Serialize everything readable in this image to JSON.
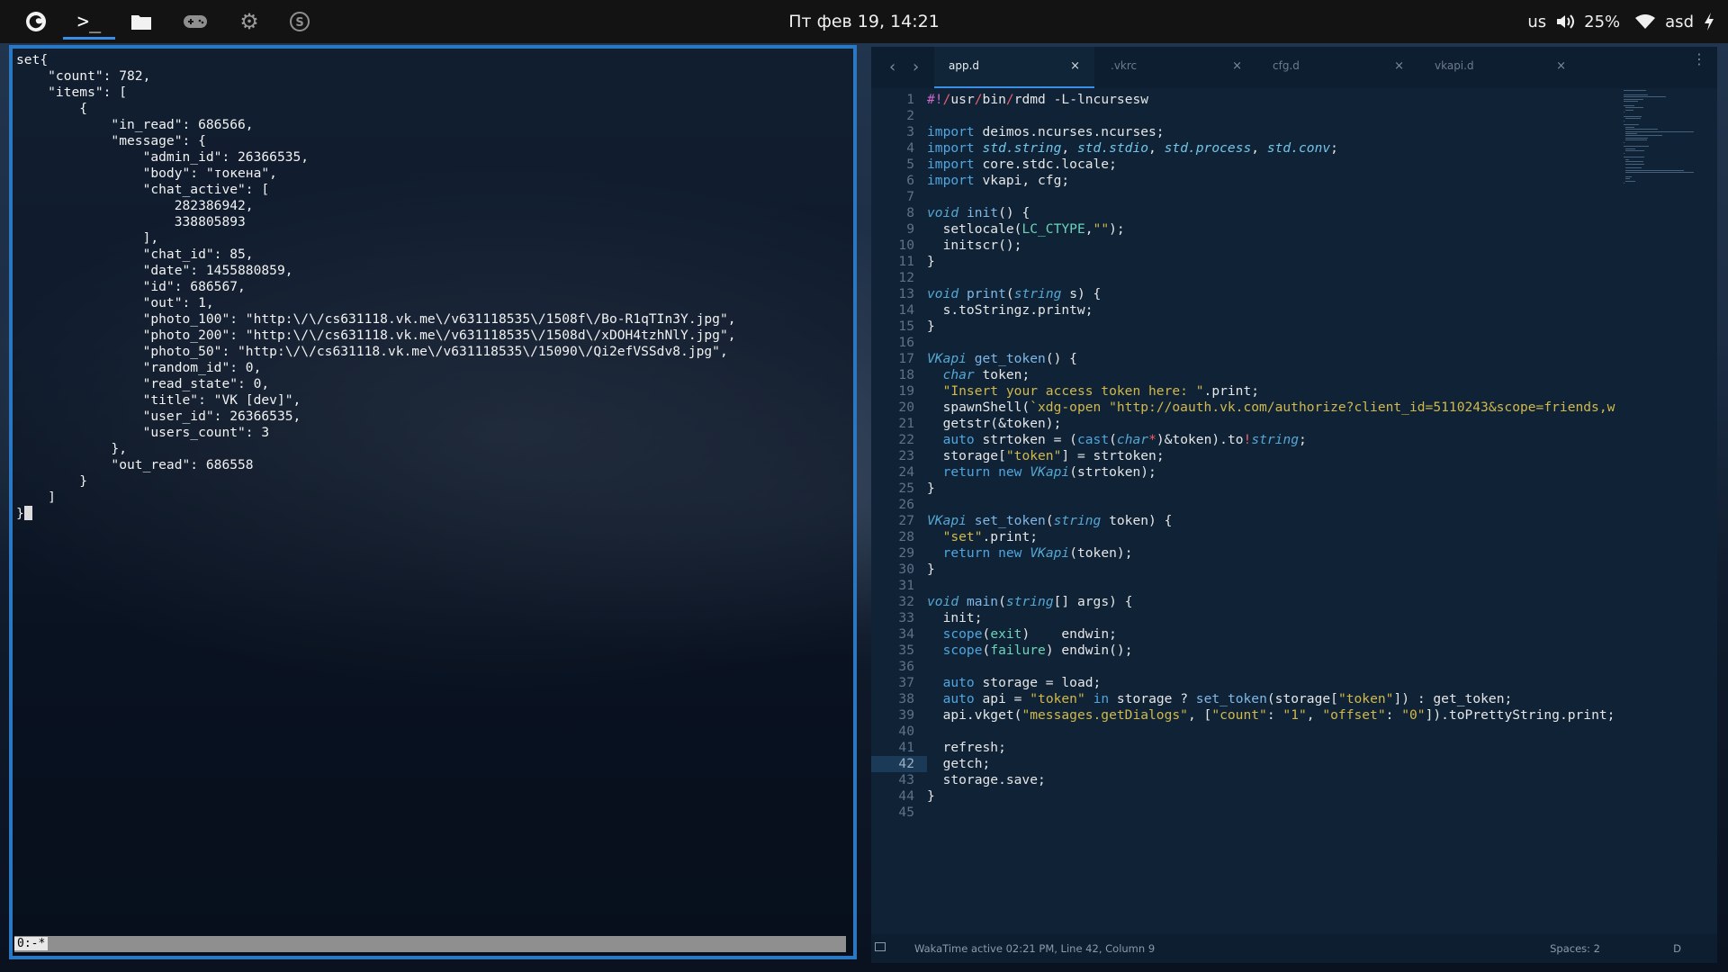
{
  "topbar": {
    "clock": "Пт фев 19, 14:21",
    "apps": [
      "firefox-icon",
      "terminal-icon",
      "folder-icon",
      "gamepad-icon",
      "gear-icon",
      "skype-icon"
    ],
    "tray": {
      "layout": "us",
      "volume": "25%",
      "network": "asd"
    }
  },
  "terminal": {
    "lines": [
      "set{",
      "    \"count\": 782,",
      "    \"items\": [",
      "        {",
      "            \"in_read\": 686566,",
      "            \"message\": {",
      "                \"admin_id\": 26366535,",
      "                \"body\": \"токена\",",
      "                \"chat_active\": [",
      "                    282386942,",
      "                    338805893",
      "                ],",
      "                \"chat_id\": 85,",
      "                \"date\": 1455880859,",
      "                \"id\": 686567,",
      "                \"out\": 1,",
      "                \"photo_100\": \"http:\\/\\/cs631118.vk.me\\/v631118535\\/1508f\\/Bo-R1qTIn3Y.jpg\",",
      "                \"photo_200\": \"http:\\/\\/cs631118.vk.me\\/v631118535\\/1508d\\/xDOH4tzhNlY.jpg\",",
      "                \"photo_50\": \"http:\\/\\/cs631118.vk.me\\/v631118535\\/15090\\/Qi2efVSSdv8.jpg\",",
      "                \"random_id\": 0,",
      "                \"read_state\": 0,",
      "                \"title\": \"VK [dev]\",",
      "                \"user_id\": 26366535,",
      "                \"users_count\": 3",
      "            },",
      "            \"out_read\": 686558",
      "        }",
      "    ]",
      "}"
    ],
    "status": "0:-*"
  },
  "editor": {
    "tabs": [
      {
        "label": "app.d",
        "active": true
      },
      {
        "label": ".vkrc",
        "active": false
      },
      {
        "label": "cfg.d",
        "active": false
      },
      {
        "label": "vkapi.d",
        "active": false
      }
    ],
    "code": [
      "#!/usr/bin/rdmd -L-lncursesw",
      "",
      "import deimos.ncurses.ncurses;",
      "import std.string, std.stdio, std.process, std.conv;",
      "import core.stdc.locale;",
      "import vkapi, cfg;",
      "",
      "void init() {",
      "  setlocale(LC_CTYPE,\"\");",
      "  initscr();",
      "}",
      "",
      "void print(string s) {",
      "  s.toStringz.printw;",
      "}",
      "",
      "VKapi get_token() {",
      "  char token;",
      "  \"Insert your access token here: \".print;",
      "  spawnShell(`xdg-open \"http://oauth.vk.com/authorize?client_id=5110243&scope=friends,w",
      "  getstr(&token);",
      "  auto strtoken = (cast(char*)&token).to!string;",
      "  storage[\"token\"] = strtoken;",
      "  return new VKapi(strtoken);",
      "}",
      "",
      "VKapi set_token(string token) {",
      "  \"set\".print;",
      "  return new VKapi(token);",
      "}",
      "",
      "void main(string[] args) {",
      "  init;",
      "  scope(exit)    endwin;",
      "  scope(failure) endwin();",
      "",
      "  auto storage = load;",
      "  auto api = \"token\" in storage ? set_token(storage[\"token\"]) : get_token;",
      "  api.vkget(\"messages.getDialogs\", [\"count\": \"1\", \"offset\": \"0\"]).toPrettyString.print;",
      "",
      "  refresh;",
      "  getch;",
      "  storage.save;",
      "}",
      ""
    ],
    "current_line": 42,
    "status": {
      "info": "WakaTime active 02:21 PM, Line 42, Column 9",
      "spaces": "Spaces: 2",
      "lang": "D"
    }
  }
}
